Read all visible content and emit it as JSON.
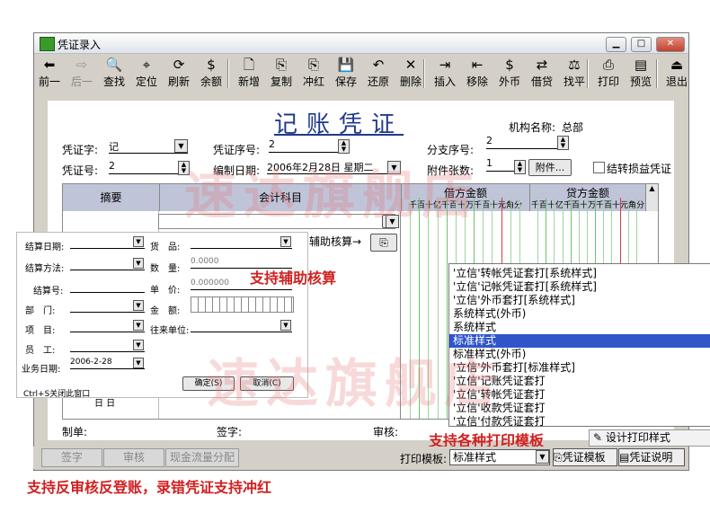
{
  "window": {
    "title": "凭证录入",
    "min_label": "▁",
    "max_label": "□",
    "close_label": "✕"
  },
  "toolbar": [
    {
      "label": "前一",
      "icon": "arrow-left-icon",
      "glyph": "⬅"
    },
    {
      "label": "后一",
      "icon": "arrow-right-icon",
      "glyph": "⇨"
    },
    {
      "label": "查找",
      "icon": "find-icon",
      "glyph": "🔍"
    },
    {
      "label": "定位",
      "icon": "locate-icon",
      "glyph": "⌖"
    },
    {
      "label": "刷新",
      "icon": "refresh-icon",
      "glyph": "⟳"
    },
    {
      "label": "余额",
      "icon": "balance-icon",
      "glyph": "$"
    },
    {
      "label": "新增",
      "icon": "new-icon",
      "glyph": "🗋"
    },
    {
      "label": "复制",
      "icon": "copy-icon",
      "glyph": "⎘"
    },
    {
      "label": "冲红",
      "icon": "red-reverse-icon",
      "glyph": "⎘"
    },
    {
      "label": "保存",
      "icon": "save-icon",
      "glyph": "💾"
    },
    {
      "label": "还原",
      "icon": "undo-icon",
      "glyph": "↶"
    },
    {
      "label": "删除",
      "icon": "delete-icon",
      "glyph": "✕"
    },
    {
      "label": "插入",
      "icon": "insert-icon",
      "glyph": "⇥"
    },
    {
      "label": "移除",
      "icon": "remove-icon",
      "glyph": "⇤"
    },
    {
      "label": "外币",
      "icon": "foreign-currency-icon",
      "glyph": "$"
    },
    {
      "label": "借贷",
      "icon": "debit-credit-icon",
      "glyph": "⇄"
    },
    {
      "label": "找平",
      "icon": "balance-scale-icon",
      "glyph": "⚖"
    },
    {
      "label": "打印",
      "icon": "print-icon",
      "glyph": "⎙"
    },
    {
      "label": "预览",
      "icon": "preview-icon",
      "glyph": "▤"
    },
    {
      "label": "退出",
      "icon": "exit-icon",
      "glyph": "⏏"
    }
  ],
  "voucher": {
    "title": "记账凭证",
    "org_label": "机构名称:",
    "org_value": "总部",
    "type_label": "凭证字:",
    "type_value": "记",
    "seq_label": "凭证序号:",
    "seq_value": "2",
    "branch_label": "分支序号:",
    "branch_value": "2",
    "number_label": "凭证号:",
    "number_value": "2",
    "date_label": "编制日期:",
    "date_value": "2006年2月28日 星期二",
    "attach_label": "附件张数:",
    "attach_value": "1",
    "attach_button": "附件...",
    "transfer_label": "结转损益凭证"
  },
  "grid": {
    "col_summary": "摘要",
    "col_account": "会计科目",
    "col_debit": "借方金额",
    "col_credit": "贷方金额",
    "digits": "千百十亿千百十万千百十元角分",
    "aux_button": "辅助核算→",
    "maker_label": "制单:",
    "signer_label": "签字:",
    "reviewer_label": "审核:"
  },
  "aux_panel": {
    "settle_date": "结算日期:",
    "settle_method": "结算方法:",
    "settle_no": "结算号:",
    "dept": "部　门:",
    "project": "项　目:",
    "staff": "员　工:",
    "biz_date": "业务日期:",
    "biz_date_value": "2006-2-28",
    "goods": "货　品:",
    "qty": "数　量:",
    "qty_value": "0.0000",
    "price": "单　价:",
    "price_value": "0.000000",
    "amount": "金　额:",
    "partner": "往来单位:",
    "ok": "确定(S)",
    "cancel": "取消(C)",
    "hint": "Ctrl+S关闭此窗口",
    "extra": "日 日"
  },
  "print_list": {
    "items": [
      "'立信'转帐凭证套打[系统样式]",
      "'立信'记帐凭证套打[系统样式]",
      "'立信'外币套打[系统样式]",
      "系统样式(外币)",
      "系统样式",
      "标准样式",
      "标准样式(外币)",
      "'立信'外币套打[标准样式]",
      "'立信'记账凭证套打",
      "'立信'转帐凭证套打",
      "'立信'收款凭证套打",
      "'立信'付款凭证套打"
    ],
    "selected_index": 5,
    "design_button": "设计打印样式"
  },
  "bottom": {
    "sign": "签字",
    "review": "审核",
    "cashflow": "现金流量分配",
    "print_template_label": "打印模板:",
    "print_template_value": "标准样式",
    "template_button": "凭证模板",
    "help_button": "凭证说明"
  },
  "annotations": {
    "aux": "支持辅助核算",
    "print": "支持各种打印模板",
    "bottom": "支持反审核反登账，录错凭证支持冲红"
  },
  "watermark": "速达旗舰店",
  "colors": {
    "annotation_red": "#d02020",
    "selection_blue": "#2f55c8",
    "title_blue": "#213a8a"
  }
}
